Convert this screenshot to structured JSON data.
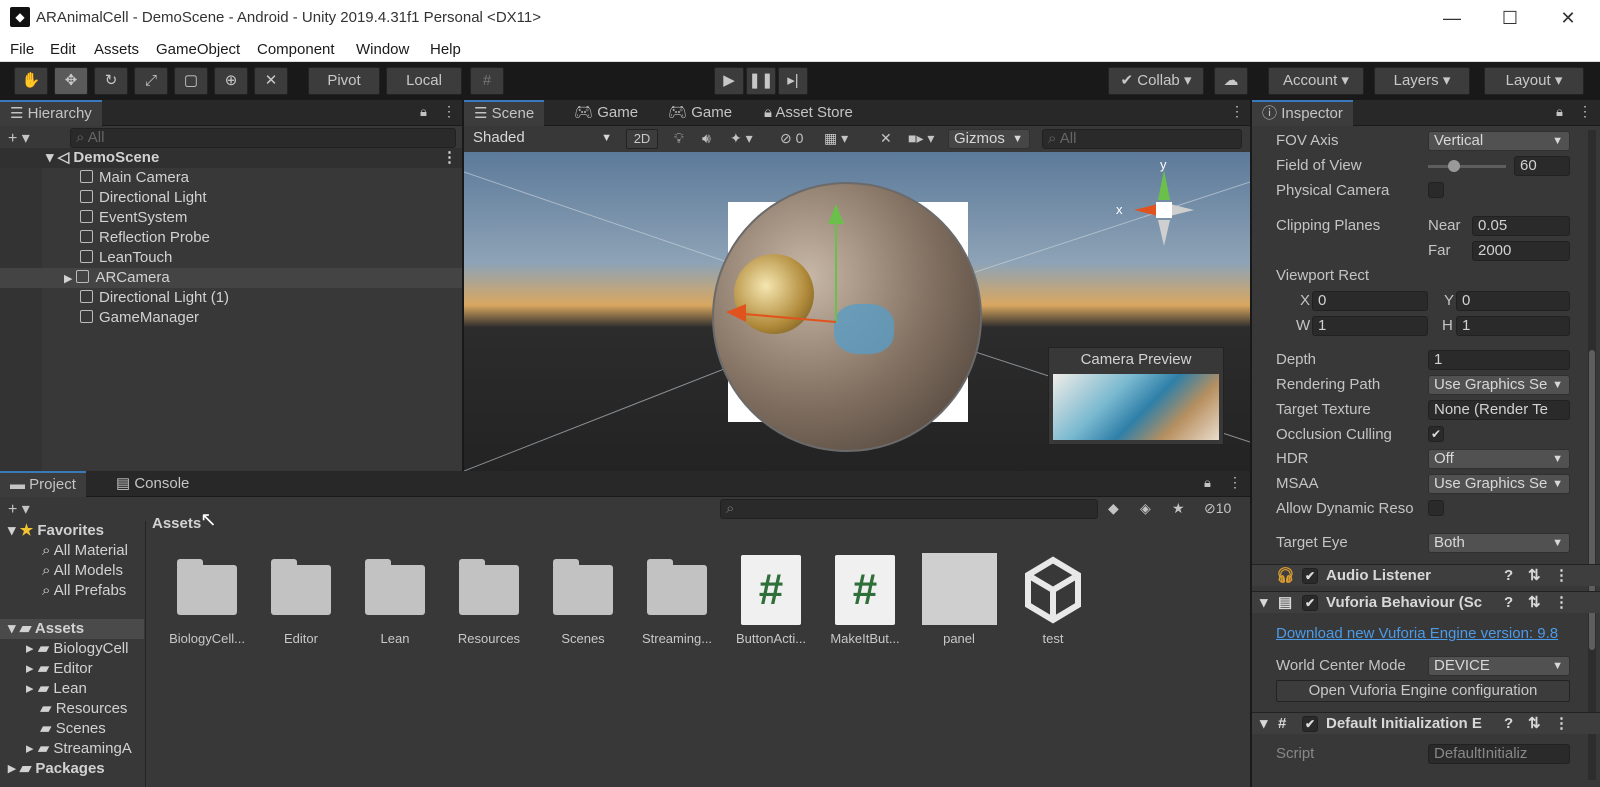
{
  "window": {
    "title": "ARAnimalCell - DemoScene - Android - Unity 2019.4.31f1 Personal <DX11>",
    "minimize": "—",
    "maximize": "☐",
    "close": "✕"
  },
  "menu": [
    "File",
    "Edit",
    "Assets",
    "GameObject",
    "Component",
    "Window",
    "Help"
  ],
  "toolbar": {
    "pivot": "Pivot",
    "local": "Local",
    "collab": "Collab",
    "account": "Account",
    "layers": "Layers",
    "layout": "Layout"
  },
  "hierarchy": {
    "tab": "Hierarchy",
    "search_placeholder": "All",
    "scene": "DemoScene",
    "items": [
      "Main Camera",
      "Directional Light",
      "EventSystem",
      "Reflection Probe",
      "LeanTouch",
      "ARCamera",
      "Directional Light (1)",
      "GameManager"
    ]
  },
  "scene_view": {
    "tabs": [
      "Scene",
      "Game",
      "Game",
      "Asset Store"
    ],
    "shading": "Shaded",
    "mode2d": "2D",
    "hidden_count": "0",
    "gizmos": "Gizmos",
    "search_placeholder": "All",
    "axis_y": "y",
    "axis_x": "x",
    "camera_preview": "Camera Preview"
  },
  "project": {
    "tabs": [
      "Project",
      "Console"
    ],
    "hidden_count": "10",
    "favorites_label": "Favorites",
    "favorites": [
      "All Material",
      "All Models",
      "All Prefabs"
    ],
    "assets_label": "Assets",
    "asset_folders": [
      "BiologyCell",
      "Editor",
      "Lean",
      "Resources",
      "Scenes",
      "StreamingA"
    ],
    "packages_label": "Packages",
    "breadcrumb": "Assets",
    "items": [
      {
        "name": "BiologyCell...",
        "kind": "folder"
      },
      {
        "name": "Editor",
        "kind": "folder"
      },
      {
        "name": "Lean",
        "kind": "folder"
      },
      {
        "name": "Resources",
        "kind": "folder"
      },
      {
        "name": "Scenes",
        "kind": "folder"
      },
      {
        "name": "Streaming...",
        "kind": "folder"
      },
      {
        "name": "ButtonActi...",
        "kind": "script"
      },
      {
        "name": "MakeItBut...",
        "kind": "script"
      },
      {
        "name": "panel",
        "kind": "image"
      },
      {
        "name": "test",
        "kind": "unity"
      }
    ]
  },
  "inspector": {
    "tab": "Inspector",
    "fov_axis_label": "FOV Axis",
    "fov_axis_value": "Vertical",
    "fov_label": "Field of View",
    "fov_value": "60",
    "fov_slider_fraction": 0.33,
    "physical_camera_label": "Physical Camera",
    "clipping_label": "Clipping Planes",
    "near_label": "Near",
    "near_value": "0.05",
    "far_label": "Far",
    "far_value": "2000",
    "viewport_label": "Viewport Rect",
    "vx_label": "X",
    "vx_value": "0",
    "vy_label": "Y",
    "vy_value": "0",
    "vw_label": "W",
    "vw_value": "1",
    "vh_label": "H",
    "vh_value": "1",
    "depth_label": "Depth",
    "depth_value": "1",
    "rendering_path_label": "Rendering Path",
    "rendering_path_value": "Use Graphics Se",
    "target_texture_label": "Target Texture",
    "target_texture_value": "None (Render Te",
    "occlusion_label": "Occlusion Culling",
    "hdr_label": "HDR",
    "hdr_value": "Off",
    "msaa_label": "MSAA",
    "msaa_value": "Use Graphics Se",
    "dynamic_res_label": "Allow Dynamic Reso",
    "target_eye_label": "Target Eye",
    "target_eye_value": "Both",
    "audio_listener": "Audio Listener",
    "vuforia_behaviour": "Vuforia Behaviour (Sc",
    "vuforia_link": "Download new Vuforia Engine version: 9.8",
    "world_center_label": "World Center Mode",
    "world_center_value": "DEVICE",
    "vuforia_config_button": "Open Vuforia Engine configuration",
    "default_init": "Default Initialization E",
    "script_label": "Script",
    "script_value": "DefaultInitializ"
  },
  "colors": {
    "accent": "#3a79bb",
    "link": "#4c9be8",
    "panel": "#383838",
    "dark": "#191919"
  }
}
